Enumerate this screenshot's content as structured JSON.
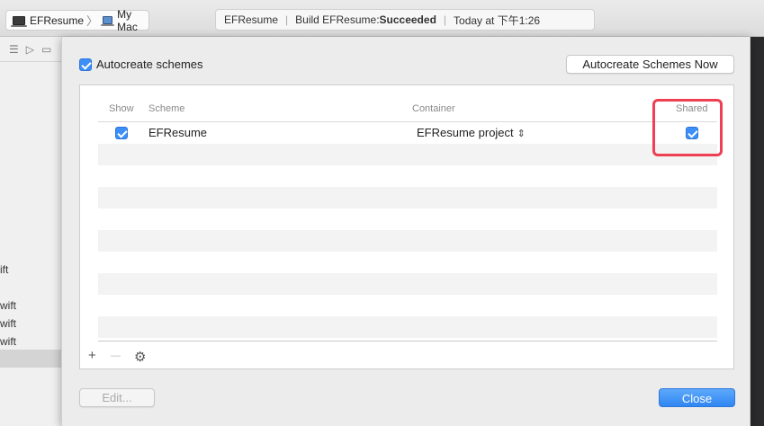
{
  "toolbar": {
    "scheme": "EFResume",
    "destination": "My Mac",
    "activity": {
      "project": "EFResume",
      "build_prefix": "Build EFResume: ",
      "build_status": "Succeeded",
      "time": "Today at 下午1:26"
    }
  },
  "navigator": {
    "files": [
      "ift",
      "wift",
      "wift",
      "wift"
    ]
  },
  "sheet": {
    "autocreate_label": "Autocreate schemes",
    "autocreate_checked": true,
    "autocreate_now_label": "Autocreate Schemes Now",
    "columns": {
      "show": "Show",
      "scheme": "Scheme",
      "container": "Container",
      "shared": "Shared"
    },
    "rows": [
      {
        "show": true,
        "scheme": "EFResume",
        "container": "EFResume project",
        "shared": true
      }
    ],
    "add_label": "+",
    "remove_label": "—",
    "edit_label": "Edit...",
    "close_label": "Close"
  },
  "colors": {
    "accent": "#3b8ff6",
    "highlight": "#ee3f53"
  }
}
